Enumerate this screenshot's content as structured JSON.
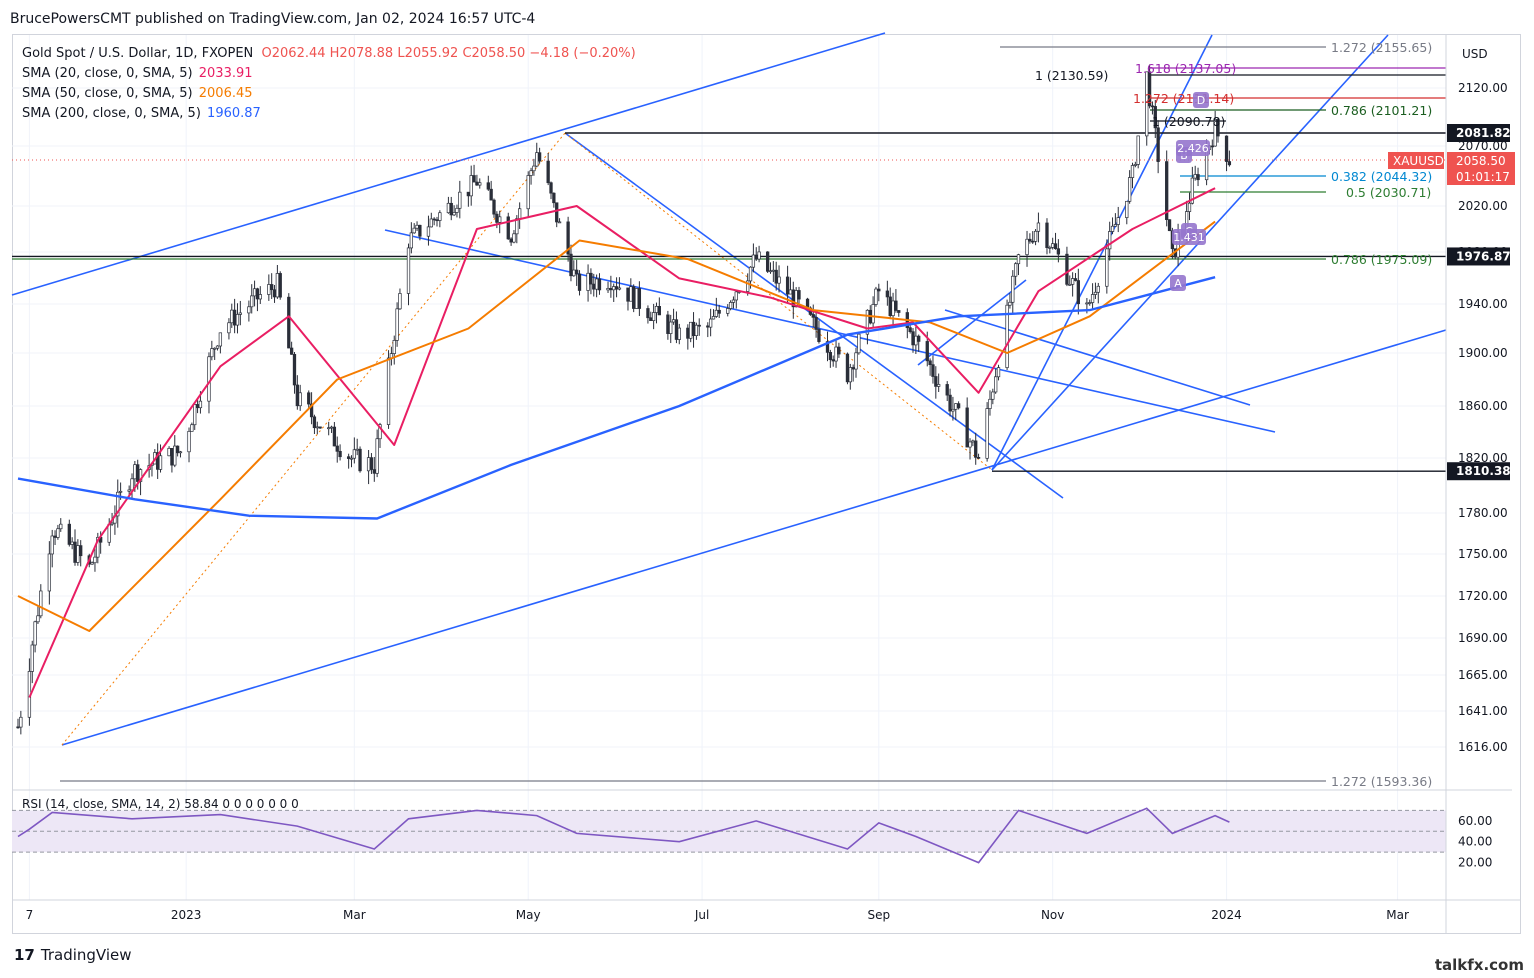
{
  "header": {
    "publisher_line": "BrucePowersCMT published on TradingView.com, Jan 02, 2024 16:57 UTC-4"
  },
  "legend": {
    "symbol": "Gold Spot / U.S. Dollar, 1D, FXOPEN",
    "ohlc": "O2062.44  H2078.88  L2055.92  C2058.50  −4.18 (−0.20%)",
    "sma20_label": "SMA (20, close, 0, SMA, 5)",
    "sma20_value": "2033.91",
    "sma50_label": "SMA (50, close, 0, SMA, 5)",
    "sma50_value": "2006.45",
    "sma200_label": "SMA (200, close, 0, SMA, 5)",
    "sma200_value": "1960.87"
  },
  "rsi_legend": "RSI (14, close, SMA, 14, 2)  58.84  0 0 0 0 0 0 0",
  "currency": "USD",
  "footer": {
    "brand": "TradingView",
    "watermark": "talkfx.com"
  },
  "colors": {
    "up": "#26a69a",
    "down": "#ef5350",
    "candle": "#2a2e39",
    "sma20": "#e91e63",
    "sma50": "#f57c00",
    "sma200": "#2962ff",
    "trend": "#2962ff",
    "rsi": "#7e57c2",
    "rsi_band": "#ede7f6"
  },
  "chart_data": {
    "type": "line",
    "title": "Gold Spot / U.S. Dollar, 1D, FXOPEN",
    "ylabel": "USD",
    "ylim": [
      1593,
      2160
    ],
    "y_ticks": [
      1616,
      1641,
      1665,
      1690,
      1720,
      1750,
      1780,
      1820,
      1860,
      1900,
      1940,
      1980,
      2020,
      2070,
      2120
    ],
    "y_tick_labels": [
      "1616.00",
      "1641.00",
      "1665.00",
      "1690.00",
      "1720.00",
      "1750.00",
      "1780.00",
      "1820.00",
      "1860.00",
      "1900.00",
      "1940.00",
      "1980.00",
      "2020.00",
      "2070.00",
      "2120.00"
    ],
    "x_ticks": [
      "7",
      "2023",
      "Mar",
      "May",
      "Jul",
      "Sep",
      "Nov",
      "2024",
      "Mar"
    ],
    "series": [
      {
        "name": "Gold Spot / U.S. Dollar",
        "points": [
          [
            "2022-11-03",
            1630
          ],
          [
            "2022-11-07",
            1675
          ],
          [
            "2022-11-15",
            1770
          ],
          [
            "2022-11-28",
            1740
          ],
          [
            "2022-12-13",
            1810
          ],
          [
            "2022-12-30",
            1825
          ],
          [
            "2023-01-13",
            1920
          ],
          [
            "2023-01-26",
            1945
          ],
          [
            "2023-02-02",
            1955
          ],
          [
            "2023-02-09",
            1865
          ],
          [
            "2023-02-28",
            1820
          ],
          [
            "2023-03-08",
            1815
          ],
          [
            "2023-03-20",
            1990
          ],
          [
            "2023-04-13",
            2040
          ],
          [
            "2023-04-25",
            1995
          ],
          [
            "2023-05-04",
            2065
          ],
          [
            "2023-05-18",
            1955
          ],
          [
            "2023-05-30",
            1960
          ],
          [
            "2023-06-23",
            1915
          ],
          [
            "2023-07-03",
            1920
          ],
          [
            "2023-07-20",
            1975
          ],
          [
            "2023-08-02",
            1945
          ],
          [
            "2023-08-21",
            1885
          ],
          [
            "2023-09-01",
            1950
          ],
          [
            "2023-09-14",
            1910
          ],
          [
            "2023-09-29",
            1850
          ],
          [
            "2023-10-06",
            1820
          ],
          [
            "2023-10-20",
            1975
          ],
          [
            "2023-10-27",
            2005
          ],
          [
            "2023-11-13",
            1935
          ],
          [
            "2023-11-29",
            2045
          ],
          [
            "2023-12-04",
            2130
          ],
          [
            "2023-12-13",
            1975
          ],
          [
            "2023-12-20",
            2035
          ],
          [
            "2023-12-28",
            2085
          ],
          [
            "2024-01-02",
            2058.5
          ]
        ]
      },
      {
        "name": "SMA (20, close, 0, SMA, 5)",
        "points": [
          [
            "2022-11-07",
            1650
          ],
          [
            "2022-12-01",
            1760
          ],
          [
            "2023-01-13",
            1890
          ],
          [
            "2023-02-06",
            1930
          ],
          [
            "2023-03-15",
            1830
          ],
          [
            "2023-04-13",
            2000
          ],
          [
            "2023-05-18",
            2020
          ],
          [
            "2023-06-23",
            1960
          ],
          [
            "2023-07-25",
            1945
          ],
          [
            "2023-08-28",
            1920
          ],
          [
            "2023-09-13",
            1925
          ],
          [
            "2023-10-06",
            1870
          ],
          [
            "2023-10-27",
            1950
          ],
          [
            "2023-11-29",
            2000
          ],
          [
            "2023-12-28",
            2033.91
          ]
        ]
      },
      {
        "name": "SMA (50, close, 0, SMA, 5)",
        "points": [
          [
            "2022-11-03",
            1720
          ],
          [
            "2022-11-28",
            1695
          ],
          [
            "2023-01-13",
            1790
          ],
          [
            "2023-02-23",
            1880
          ],
          [
            "2023-04-10",
            1920
          ],
          [
            "2023-05-19",
            1990
          ],
          [
            "2023-06-26",
            1975
          ],
          [
            "2023-08-09",
            1935
          ],
          [
            "2023-09-19",
            1925
          ],
          [
            "2023-10-16",
            1900
          ],
          [
            "2023-11-14",
            1930
          ],
          [
            "2023-12-28",
            2006.45
          ]
        ]
      },
      {
        "name": "SMA (200, close, 0, SMA, 5)",
        "points": [
          [
            "2022-11-03",
            1805
          ],
          [
            "2022-12-14",
            1790
          ],
          [
            "2023-01-23",
            1778
          ],
          [
            "2023-03-09",
            1776
          ],
          [
            "2023-04-25",
            1815
          ],
          [
            "2023-06-23",
            1860
          ],
          [
            "2023-08-21",
            1915
          ],
          [
            "2023-09-29",
            1930
          ],
          [
            "2023-11-14",
            1935
          ],
          [
            "2023-12-28",
            1960.87
          ]
        ]
      },
      {
        "name": "RSI (14, close, SMA, 14, 2)",
        "values_note": "oscillator 0-100",
        "points": [
          [
            "2022-11-03",
            45
          ],
          [
            "2022-11-07",
            52
          ],
          [
            "2022-11-15",
            68
          ],
          [
            "2022-12-13",
            62
          ],
          [
            "2023-01-13",
            66
          ],
          [
            "2023-02-09",
            55
          ],
          [
            "2023-03-08",
            33
          ],
          [
            "2023-03-20",
            62
          ],
          [
            "2023-04-13",
            70
          ],
          [
            "2023-05-04",
            65
          ],
          [
            "2023-05-18",
            48
          ],
          [
            "2023-06-23",
            40
          ],
          [
            "2023-07-20",
            60
          ],
          [
            "2023-08-21",
            33
          ],
          [
            "2023-09-01",
            58
          ],
          [
            "2023-09-14",
            45
          ],
          [
            "2023-10-06",
            20
          ],
          [
            "2023-10-20",
            70
          ],
          [
            "2023-11-13",
            48
          ],
          [
            "2023-12-04",
            72
          ],
          [
            "2023-12-13",
            48
          ],
          [
            "2023-12-28",
            65
          ],
          [
            "2024-01-02",
            58.84
          ]
        ]
      }
    ],
    "annotations": {
      "fib_levels": [
        {
          "label": "1.272 (2155.65)",
          "value": 2155.65,
          "color": "#787b86"
        },
        {
          "label": "1 (2130.59)",
          "value": 2130.59,
          "color": "#131722"
        },
        {
          "label": "1.618 (2137.05)",
          "value": 2137.05,
          "color": "#9c27b0"
        },
        {
          "label": "1.272 (2111.14)",
          "value": 2111.14,
          "color": "#d32f2f"
        },
        {
          "label": "0.786 (2101.21)",
          "value": 2101.21,
          "color": "#1b5e20"
        },
        {
          "label": "1 (2090.78)",
          "value": 2090.78,
          "color": "#131722"
        },
        {
          "label": "0.382 (2044.32)",
          "value": 2044.32,
          "color": "#0288d1"
        },
        {
          "label": "0.5 (2030.71)",
          "value": 2030.71,
          "color": "#2e7d32"
        },
        {
          "label": "0.786 (1975.09)",
          "value": 1975.09,
          "color": "#2e7d32"
        },
        {
          "label": "1.272 (1593.36)",
          "value": 1593.36,
          "color": "#787b86"
        }
      ],
      "price_tags": [
        {
          "label": "2081.82",
          "value": 2081.82
        },
        {
          "label": "1976.87",
          "value": 1976.87
        },
        {
          "label": "1810.38",
          "value": 1810.38
        }
      ],
      "last_price_label": "XAUUSD",
      "last_price": "2058.50",
      "countdown": "01:01:17",
      "pattern_labels": [
        "A",
        "B",
        "C",
        "D",
        "2.426",
        "1.431"
      ],
      "rsi_ticks": [
        "60.00",
        "40.00",
        "20.00"
      ]
    }
  }
}
